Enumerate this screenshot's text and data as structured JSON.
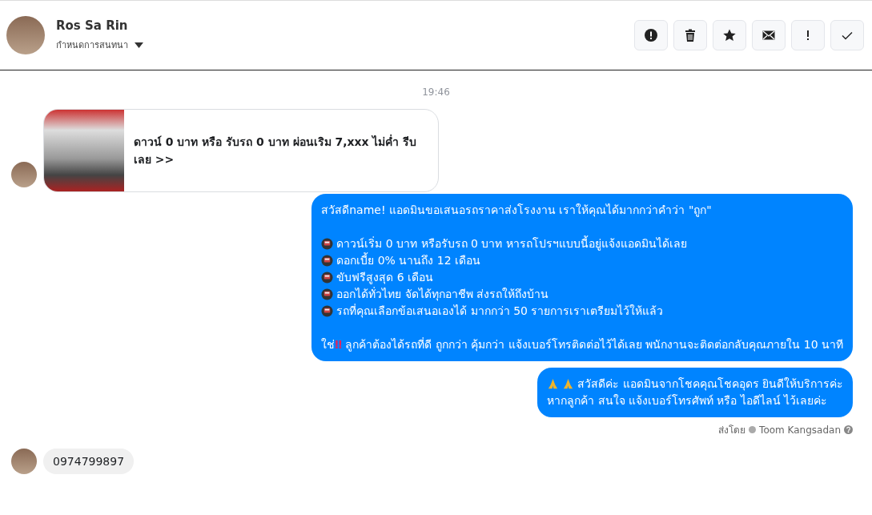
{
  "header": {
    "name": "Ros Sa Rin",
    "subtitle": "กำหนดการสนทนา",
    "actions": [
      {
        "kind": "alert"
      },
      {
        "kind": "trash"
      },
      {
        "kind": "star"
      },
      {
        "kind": "mail"
      },
      {
        "kind": "bang"
      },
      {
        "kind": "check"
      }
    ]
  },
  "timestamp": "19:46",
  "messages": [
    {
      "kind": "card",
      "outgoing": false,
      "text": "ดาวน์ 0 บาท หรือ รับรถ 0 บาท ผ่อนเริม 7,xxx ไม่ค่ำ รีบเลย >>"
    },
    {
      "kind": "lines",
      "outgoing": true,
      "lines": [
        {
          "kind": "plain",
          "text": "สวัสดีname! แอดมินขอเสนอรถราคาส่งโรงงาน เราให้คุณได้มากกว่าคำว่า \"ถูก\""
        },
        {
          "kind": "blank"
        },
        {
          "kind": "bullet",
          "text": "ดาวน์เริ่ม 0 บาท หรือรับรถ 0 บาท หารถโปรฯแบบนี้อยู่แจ้งแอดมินได้เลย"
        },
        {
          "kind": "bullet",
          "text": "ดอกเบี้ย 0% นานถึง 12 เดือน"
        },
        {
          "kind": "bullet",
          "text": "ขับฟรีสูงสุด 6 เดือน"
        },
        {
          "kind": "bullet",
          "text": "ออกได้ทั่วไทย จัดได้ทุกอาชีพ ส่งรถให้ถึงบ้าน"
        },
        {
          "kind": "bullet",
          "text": "รถที่คุณเลือกข้อเสนอเองได้ มากกว่า 50 รายการเราเตรียมไว้ให้แล้ว"
        },
        {
          "kind": "blank"
        },
        {
          "kind": "alert",
          "before": "ใช่",
          "mark": "‼",
          "text": "ลูกค้าต้องได้รถที่ดี ถูกกว่า คุ้มกว่า แจ้งเบอร์โทรติดต่อไว้ได้เลย พนักงานจะติดต่อกลับคุณภายใน 10 นาที"
        }
      ]
    },
    {
      "kind": "lines",
      "outgoing": true,
      "lines": [
        {
          "kind": "pray",
          "text": "สวัสดีค่ะ แอดมินจากโชคคุณโชคอุดร ยินดีให้บริการค่ะ"
        },
        {
          "kind": "plain",
          "text": "หากลูกค้า สนใจ แจ้งเบอร์โทรศัพท์ หรือ ไอดีไลน์  ไว้เลยค่ะ"
        }
      ],
      "sent_by_label": "ส่งโดย",
      "sent_by": "Toom Kangsadan"
    },
    {
      "kind": "text",
      "outgoing": false,
      "text": "0974799897"
    }
  ]
}
